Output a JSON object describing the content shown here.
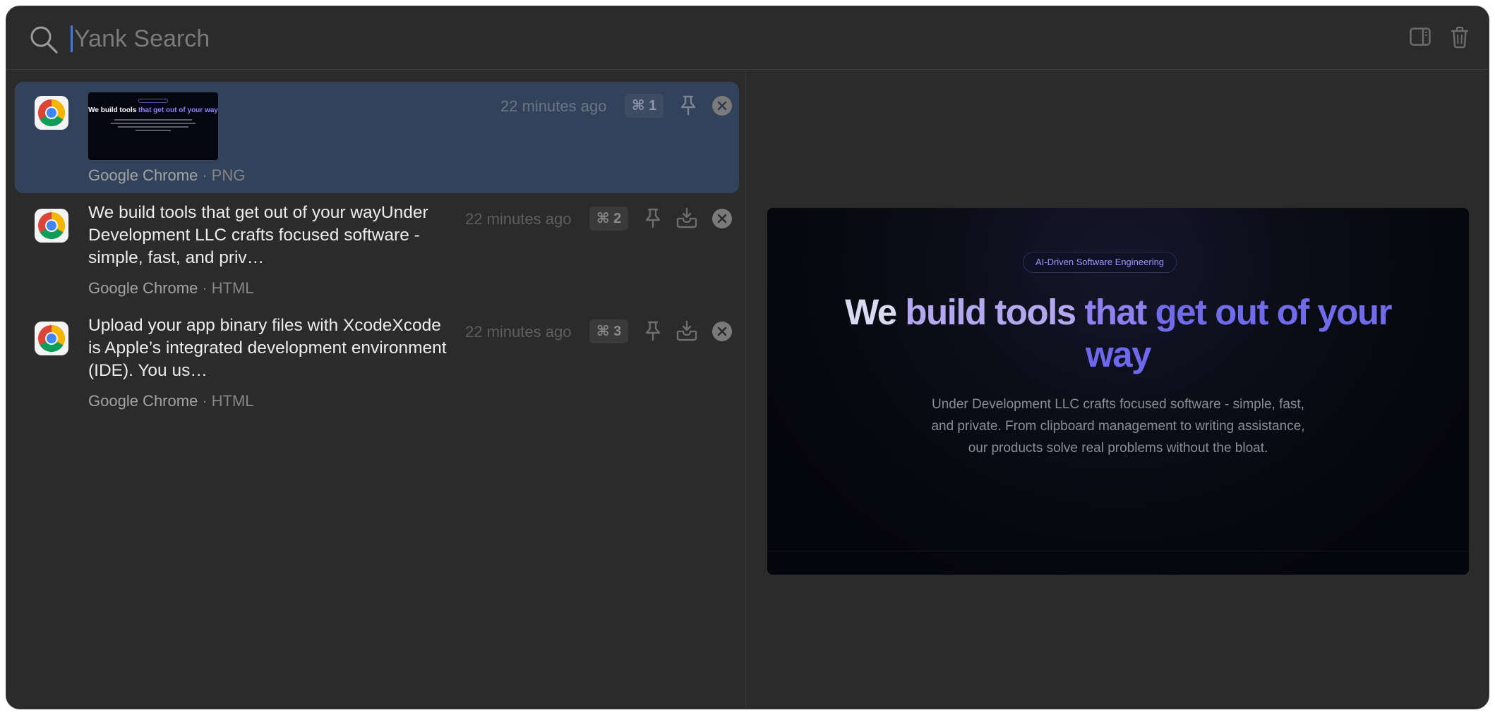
{
  "search": {
    "placeholder": "Yank Search",
    "value": ""
  },
  "items": [
    {
      "app": "Google Chrome",
      "type": "PNG",
      "time": "22 minutes ago",
      "shortcut": "⌘ 1",
      "thumbnail": {
        "pill": "",
        "title_a": "We build tools ",
        "title_b": "that get out of your way"
      }
    },
    {
      "app": "Google Chrome",
      "type": "HTML",
      "time": "22 minutes ago",
      "shortcut": "⌘ 2",
      "text": "We build tools that get out of your wayUnder Development LLC crafts focused software - simple, fast, and priv…"
    },
    {
      "app": "Google Chrome",
      "type": "HTML",
      "time": "22 minutes ago",
      "shortcut": "⌘ 3",
      "text": "Upload your app binary files with XcodeXcode is Apple’s integrated development environment (IDE). You us…"
    }
  ],
  "preview": {
    "badge": "AI-Driven Software Engineering",
    "hero_words": [
      "We",
      "build tools",
      "that",
      "get out of your",
      "way"
    ],
    "subtitle": "Under Development LLC crafts focused software - simple, fast, and private. From clipboard management to writing assistance, our products solve real problems without the bloat."
  },
  "colors": {
    "accent": "#3d7bfd",
    "selected_row": "#33425b",
    "window": "#2b2b2b"
  },
  "icons": [
    "search-icon",
    "sidebar-toggle-icon",
    "trash-icon",
    "chrome-icon",
    "pin-icon",
    "save-icon",
    "close-icon"
  ]
}
